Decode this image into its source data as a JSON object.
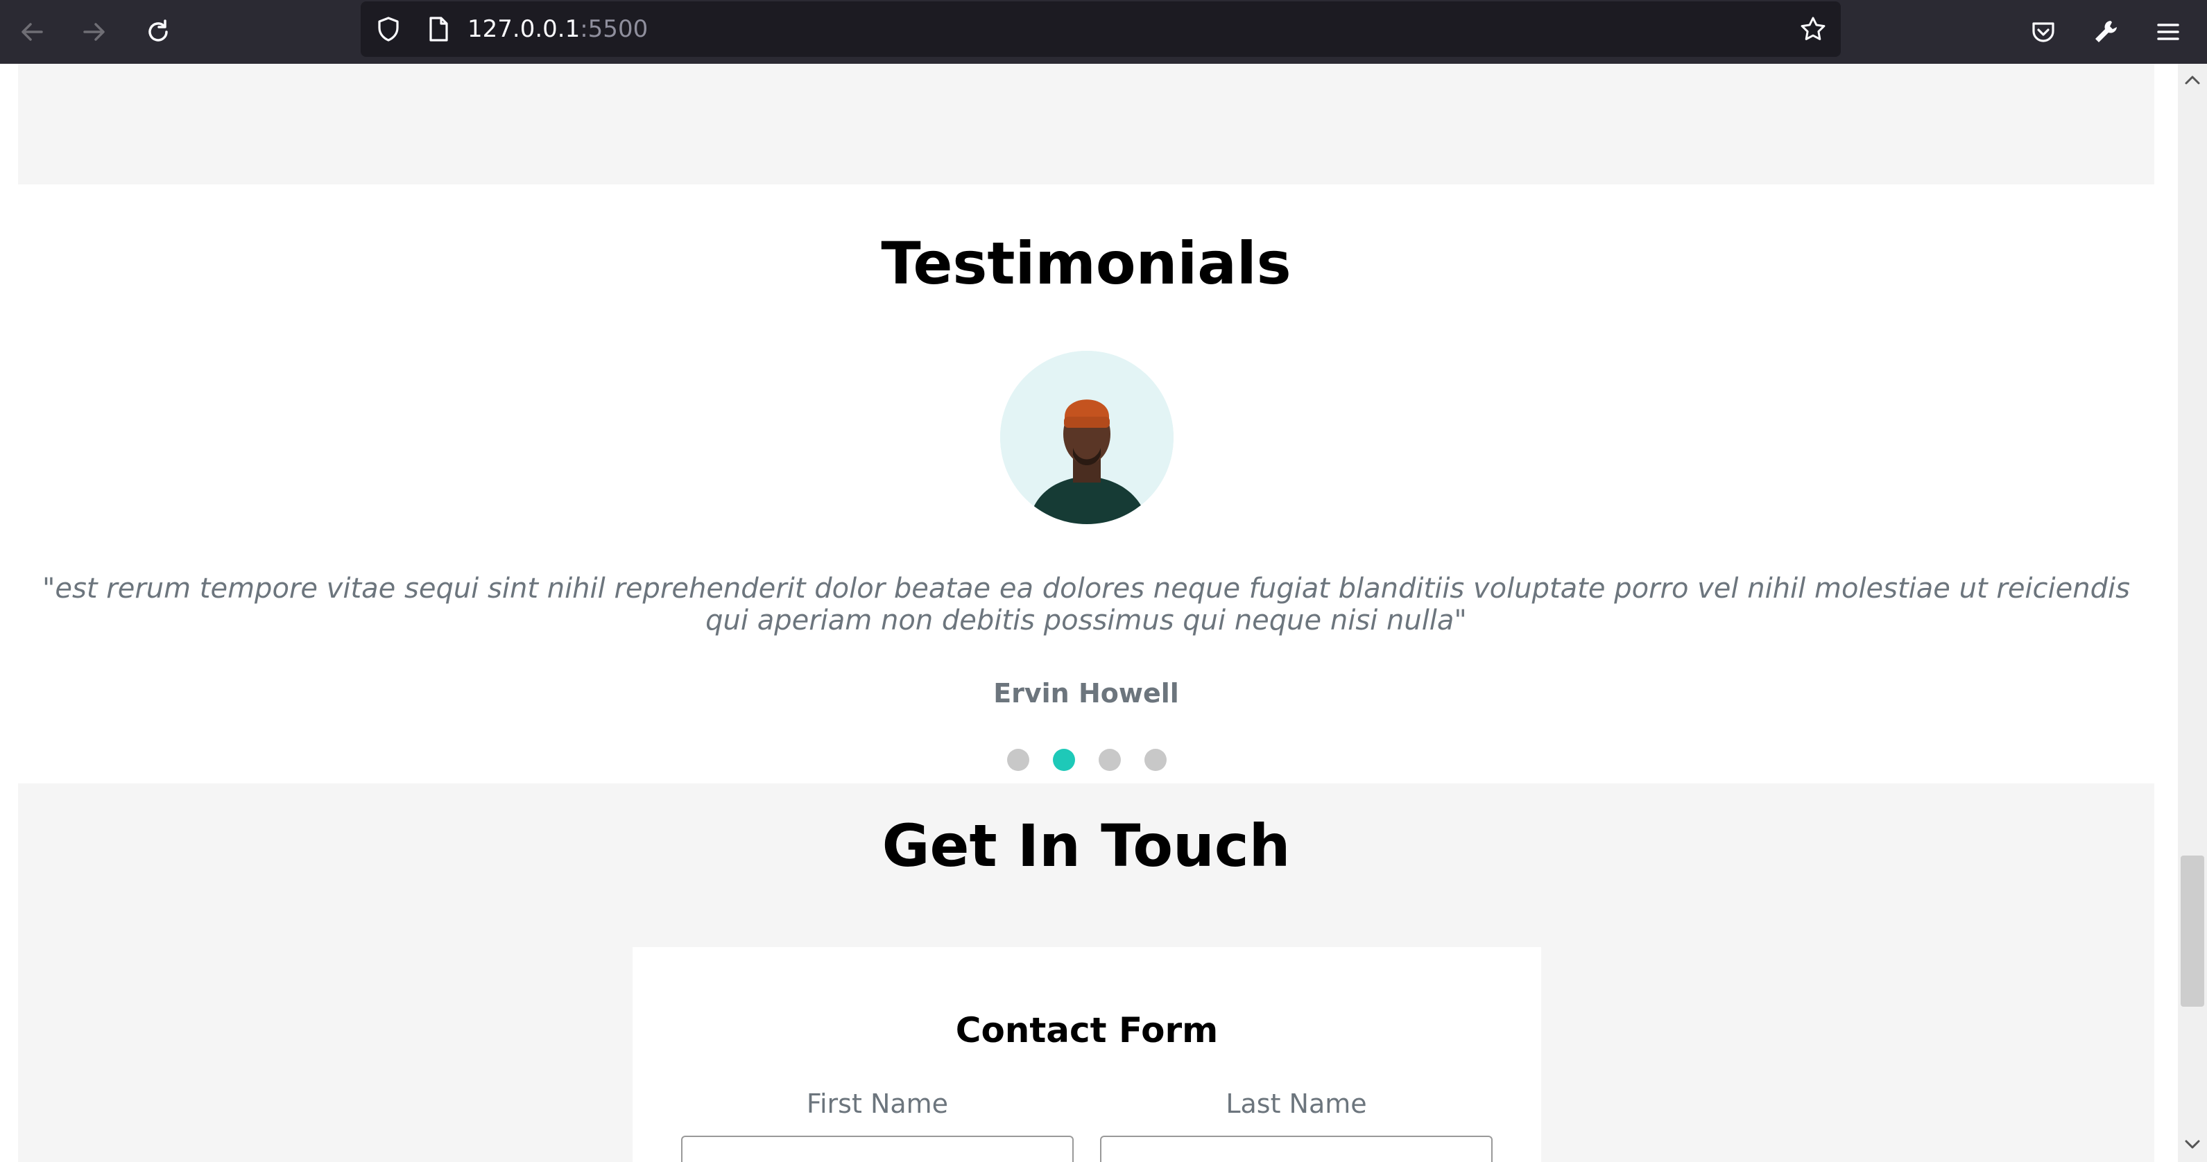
{
  "browser": {
    "url_host": "127.0.0.1",
    "url_port": ":5500",
    "icons": [
      "back-arrow-icon",
      "forward-arrow-icon",
      "reload-icon",
      "shield-icon",
      "page-icon",
      "star-icon",
      "pocket-icon",
      "wrench-icon",
      "menu-icon"
    ]
  },
  "testimonials": {
    "title": "Testimonials",
    "quote": "\"est rerum tempore vitae sequi sint nihil reprehenderit dolor beatae ea dolores neque fugiat blanditiis voluptate porro vel nihil molestiae ut reiciendis qui aperiam non debitis possimus qui neque nisi nulla\"",
    "author": "Ervin Howell",
    "slides_total": 4,
    "active_slide": 2,
    "accent_color": "#1ec9b8"
  },
  "contact": {
    "title": "Get In Touch",
    "form_title": "Contact Form",
    "first_name_label": "First Name",
    "last_name_label": "Last Name"
  }
}
